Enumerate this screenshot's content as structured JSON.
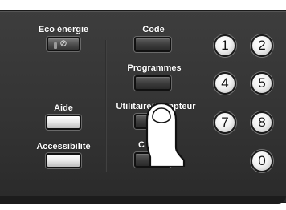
{
  "panel": {
    "eco_label": "Eco énergie",
    "aide_label": "Aide",
    "accessibilite_label": "Accessibilité",
    "code_label": "Code",
    "programmes_label": "Programmes",
    "utilitaire_label": "Utilitaire/Compteur",
    "hidden_label_left": "C",
    "hidden_label_right": "e"
  },
  "keypad": {
    "keys": [
      "1",
      "2",
      "4",
      "5",
      "7",
      "8",
      "0"
    ]
  },
  "icons": {
    "eco": "power-icon",
    "pointer": "pointing-finger-icon"
  }
}
